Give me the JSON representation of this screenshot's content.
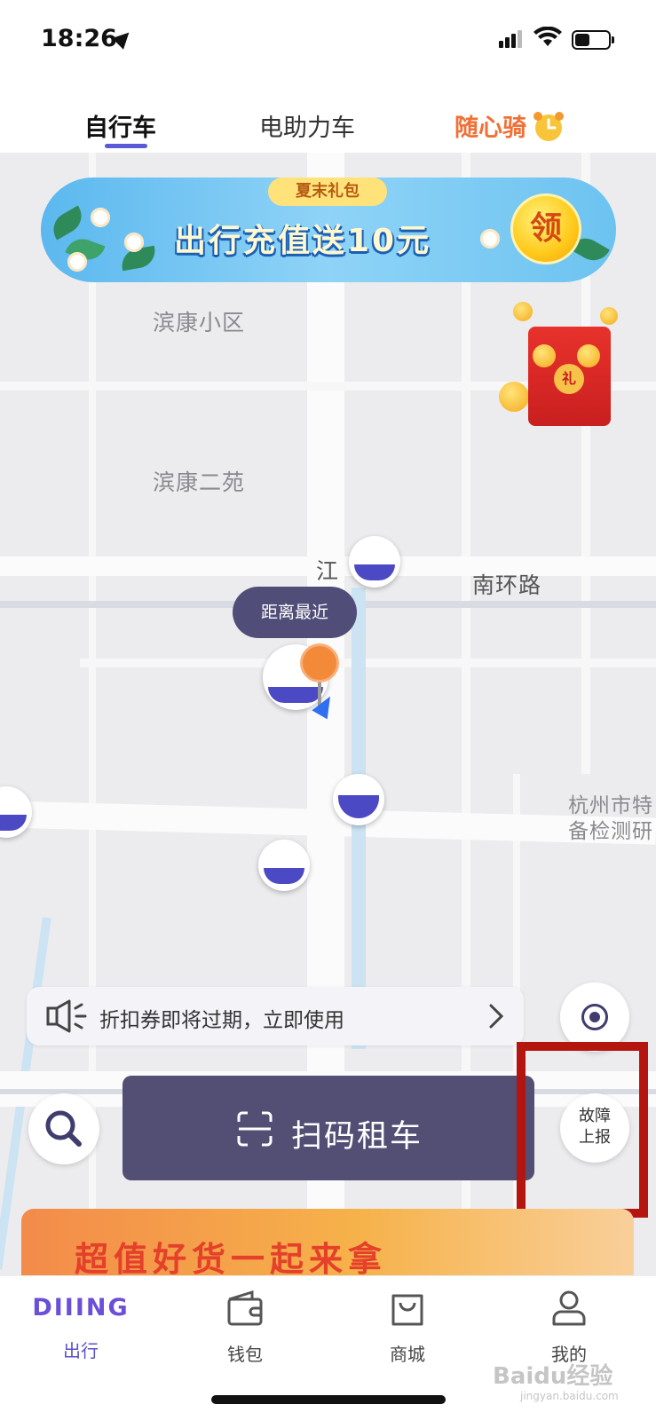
{
  "status_bar": {
    "time": "18:26"
  },
  "top_tabs": [
    {
      "label": "自行车",
      "active": true
    },
    {
      "label": "电助力车",
      "active": false
    },
    {
      "label": "随心骑",
      "active": false
    }
  ],
  "promo_banner": {
    "tag": "夏末礼包",
    "text": "出行充值送10元",
    "coin_label": "领"
  },
  "red_packet": {
    "seal": "礼"
  },
  "map_labels": {
    "area1": "滨康小区",
    "area2": "滨康二苑",
    "road1": "南环路",
    "river": "江",
    "poi_line1": "杭州市特",
    "poi_line2": "备检测研"
  },
  "nearest_bubble": "距离最近",
  "notice": {
    "text": "折扣券即将过期，立即使用"
  },
  "scan_button": {
    "label": "扫码租车"
  },
  "report_button": {
    "line1": "故障",
    "line2": "上报"
  },
  "bottom_promo": {
    "text": "超值好货一起来拿"
  },
  "bottom_tabs": {
    "brand": "DIIING",
    "items": [
      {
        "label": "出行",
        "icon": "bike-brand-icon",
        "active": true
      },
      {
        "label": "钱包",
        "icon": "wallet-icon",
        "active": false
      },
      {
        "label": "商城",
        "icon": "shopping-bag-icon",
        "active": false
      },
      {
        "label": "我的",
        "icon": "user-icon",
        "active": false
      }
    ]
  },
  "watermark": {
    "main": "Baidu经验",
    "sub": "jingyan.baidu.com"
  },
  "colors": {
    "accent": "#5a52c8",
    "scan_button": "#524e74",
    "highlight": "#b5150f",
    "suixin": "#f07036"
  }
}
